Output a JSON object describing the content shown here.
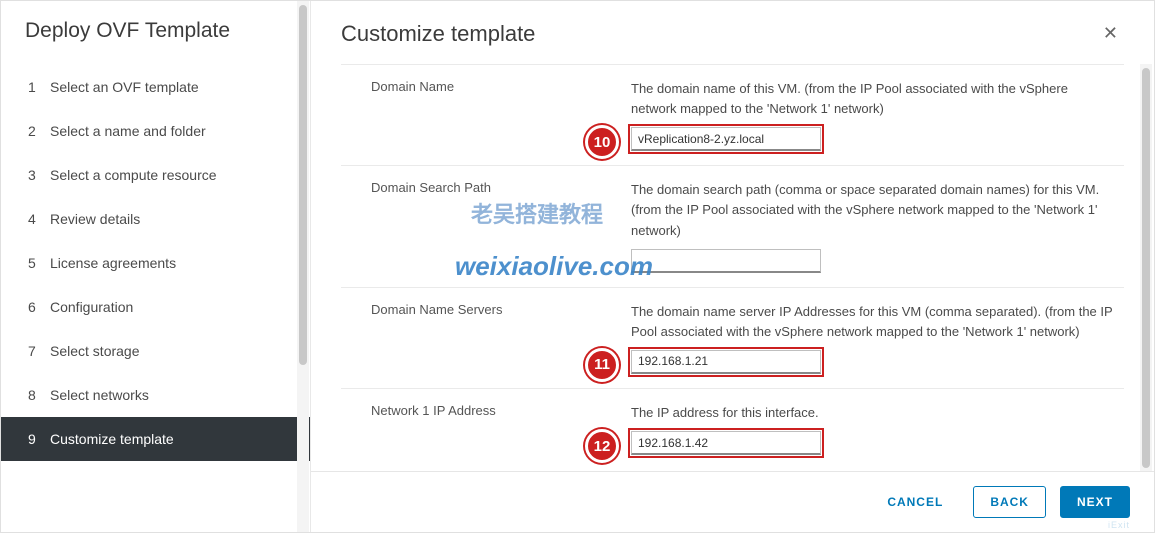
{
  "wizard": {
    "title": "Deploy OVF Template",
    "steps": [
      {
        "num": "1",
        "label": "Select an OVF template"
      },
      {
        "num": "2",
        "label": "Select a name and folder"
      },
      {
        "num": "3",
        "label": "Select a compute resource"
      },
      {
        "num": "4",
        "label": "Review details"
      },
      {
        "num": "5",
        "label": "License agreements"
      },
      {
        "num": "6",
        "label": "Configuration"
      },
      {
        "num": "7",
        "label": "Select storage"
      },
      {
        "num": "8",
        "label": "Select networks"
      },
      {
        "num": "9",
        "label": "Customize template"
      }
    ],
    "active_index": 8
  },
  "page": {
    "title": "Customize template"
  },
  "fields": {
    "domain_name": {
      "label": "Domain Name",
      "desc": "The domain name of this VM. (from the IP Pool associated with the vSphere network mapped to the 'Network 1' network)",
      "value": "vReplication8-2.yz.local"
    },
    "domain_search_path": {
      "label": "Domain Search Path",
      "desc": "The domain search path (comma or space separated domain names) for this VM. (from the IP Pool associated with the vSphere network mapped to the 'Network 1' network)",
      "value": ""
    },
    "dns": {
      "label": "Domain Name Servers",
      "desc": "The domain name server IP Addresses for this VM (comma separated). (from the IP Pool associated with the vSphere network mapped to the 'Network 1' network)",
      "value": "192.168.1.21"
    },
    "net1_ip": {
      "label": "Network 1 IP Address",
      "desc": "The IP address for this interface.",
      "value": "192.168.1.42"
    }
  },
  "badges": {
    "b10": "10",
    "b11": "11",
    "b12": "12"
  },
  "footer": {
    "cancel": "CANCEL",
    "back": "BACK",
    "next": "NEXT",
    "next_sub": "iExit"
  },
  "watermark": {
    "line1": "老吴搭建教程",
    "line2": "weixiaolive.com"
  }
}
